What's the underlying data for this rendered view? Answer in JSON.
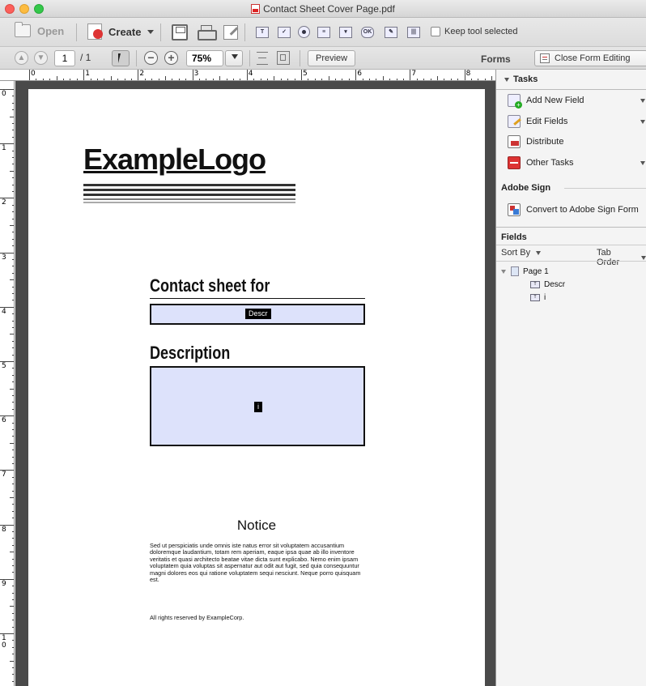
{
  "window": {
    "title": "Contact Sheet Cover Page.pdf"
  },
  "toolbar": {
    "open_label": "Open",
    "create_label": "Create",
    "keep_tool_label": "Keep tool selected",
    "page_number": "1",
    "page_total": "/ 1",
    "zoom": "75%",
    "preview_label": "Preview",
    "forms_label": "Forms",
    "close_form_label": "Close Form Editing"
  },
  "rulers": {
    "horizontal": [
      "0",
      "1",
      "2",
      "3",
      "4",
      "5",
      "6",
      "7",
      "8"
    ],
    "vertical": [
      "0",
      "1",
      "2",
      "3",
      "4",
      "5",
      "6",
      "7",
      "8",
      "9",
      "10"
    ]
  },
  "document": {
    "logo": "ExampleLogo",
    "contact_heading": "Contact sheet for",
    "contact_field_tag": "Descr",
    "description_heading": "Description",
    "description_field_tag": "i",
    "notice_heading": "Notice",
    "notice_body": "Sed ut perspiciatis unde omnis iste natus error sit voluptatem accusantium doloremque laudantium, totam rem aperiam, eaque ipsa quae ab illo inventore veritatis et quasi architecto beatae vitae dicta sunt explicabo. Nemo enim ipsam voluptatem quia voluptas sit aspernatur aut odit aut fugit, sed quia consequuntur magni dolores eos qui ratione voluptatem sequi nesciunt. Neque porro quisquam est.",
    "rights": "All rights reserved by ExampleCorp."
  },
  "panel": {
    "tasks_heading": "Tasks",
    "tasks": [
      {
        "label": "Add New Field",
        "icon": "add-field-icon"
      },
      {
        "label": "Edit Fields",
        "icon": "edit-fields-icon"
      },
      {
        "label": "Distribute",
        "icon": "distribute-icon"
      },
      {
        "label": "Other Tasks",
        "icon": "other-tasks-icon"
      }
    ],
    "adobe_sign_heading": "Adobe Sign",
    "adobe_sign_action": "Convert to Adobe Sign Form",
    "fields_heading": "Fields",
    "sort_by_label": "Sort By",
    "tab_order_label": "Tab Order",
    "tree": {
      "page_label": "Page 1",
      "fields": [
        "Descr",
        "i"
      ]
    }
  },
  "colors": {
    "field_fill": "#dde2fb",
    "doc_background": "#4a4a4a",
    "close_button": "#fc605b",
    "minimize_button": "#fdbc40",
    "maximize_button": "#34c84a"
  }
}
